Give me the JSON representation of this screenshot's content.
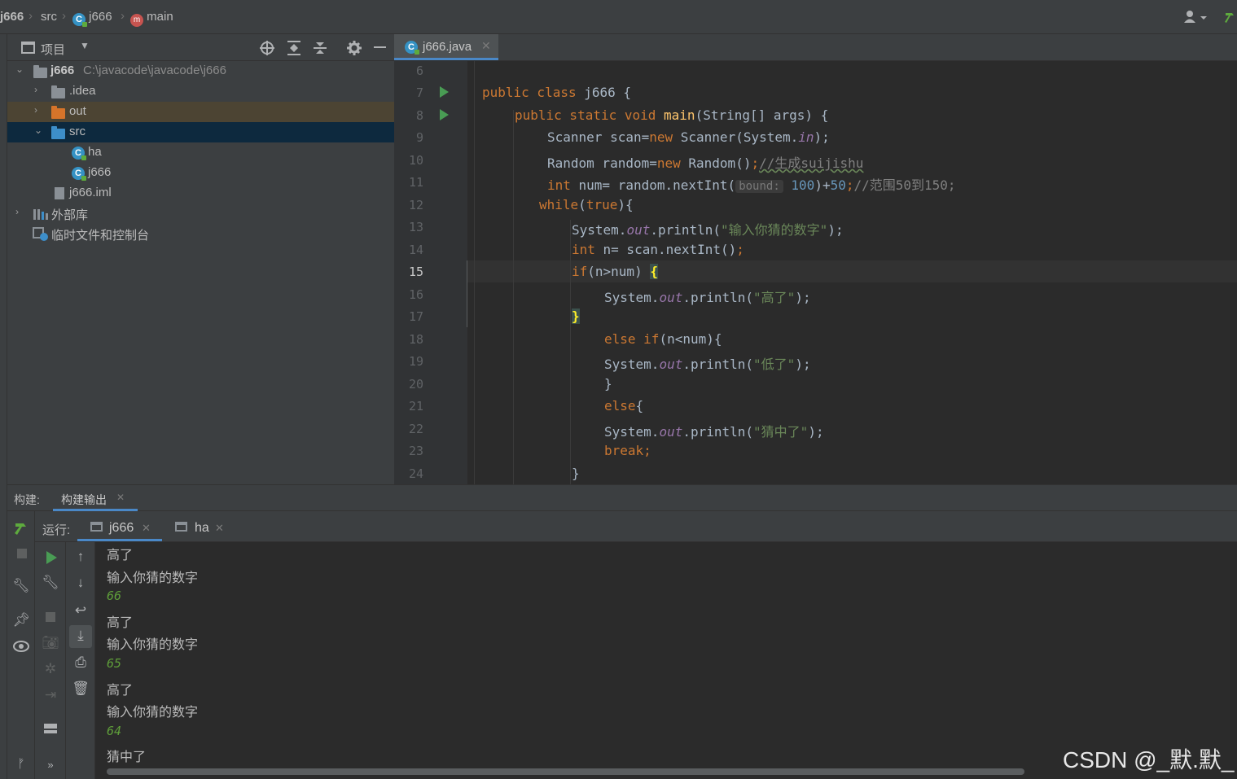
{
  "breadcrumb": {
    "project": "j666",
    "folder": "src",
    "file": "j666",
    "method": "main"
  },
  "project_panel": {
    "title": "项目",
    "tree": [
      {
        "label": "j666",
        "path": "C:\\javacode\\javacode\\j666"
      },
      {
        "label": ".idea"
      },
      {
        "label": "out"
      },
      {
        "label": "src"
      },
      {
        "label": "ha"
      },
      {
        "label": "j666"
      },
      {
        "label": "j666.iml"
      },
      {
        "label": "外部库"
      },
      {
        "label": "临时文件和控制台"
      }
    ]
  },
  "editor": {
    "tab": "j666.java",
    "line_numbers": [
      "6",
      "7",
      "8",
      "9",
      "10",
      "11",
      "12",
      "13",
      "14",
      "15",
      "16",
      "17",
      "18",
      "19",
      "20",
      "21",
      "22",
      "23",
      "24"
    ],
    "current_line": "15",
    "inlay_hint": "bound:",
    "lines": {
      "l7": {
        "a": "public class ",
        "b": "j666 {"
      },
      "l8": {
        "a": "public static void ",
        "b": "main",
        "c": "(String[] args) {"
      },
      "l9": {
        "a": "Scanner scan=",
        "b": "new ",
        "c": "Scanner(System.",
        "d": "in",
        "e": ");"
      },
      "l10": {
        "a": "Random random=",
        "b": "new ",
        "c": "Random()",
        "d": ";",
        "e": "//生成suijishu"
      },
      "l11": {
        "a": "int ",
        "b": "num= random.nextInt(",
        "c": "100",
        "d": ")+",
        "e": "50",
        "f": ";",
        "g": "//范围50到150;"
      },
      "l12": {
        "a": "while",
        "b": "(",
        "c": "true",
        "d": "){"
      },
      "l13": {
        "a": "System.",
        "b": "out",
        "c": ".println(",
        "d": "\"输入你猜的数字\"",
        "e": ");"
      },
      "l14": {
        "a": "int ",
        "b": "n= scan.nextInt()",
        "c": ";"
      },
      "l15": {
        "a": "if",
        "b": "(n>num) ",
        "c": "{"
      },
      "l16": {
        "a": "System.",
        "b": "out",
        "c": ".println(",
        "d": "\"高了\"",
        "e": ");"
      },
      "l17": {
        "a": "}"
      },
      "l18": {
        "a": "else if",
        "b": "(n<num){"
      },
      "l19": {
        "a": "System.",
        "b": "out",
        "c": ".println(",
        "d": "\"低了\"",
        "e": ");"
      },
      "l20": {
        "a": "}"
      },
      "l21": {
        "a": "else",
        "b": "{"
      },
      "l22": {
        "a": "System.",
        "b": "out",
        "c": ".println(",
        "d": "\"猜中了\"",
        "e": ");"
      },
      "l23": {
        "a": "break;"
      },
      "l24": {
        "a": "}"
      }
    }
  },
  "build": {
    "label": "构建:",
    "tab": "构建输出"
  },
  "run": {
    "label": "运行:",
    "tabs": [
      "j666",
      "ha"
    ]
  },
  "console": [
    {
      "text": "高了",
      "input": false
    },
    {
      "text": "输入你猜的数字",
      "input": false
    },
    {
      "text": "66",
      "input": true
    },
    {
      "text": "高了",
      "input": false
    },
    {
      "text": "输入你猜的数字",
      "input": false
    },
    {
      "text": "65",
      "input": true
    },
    {
      "text": "高了",
      "input": false
    },
    {
      "text": "输入你猜的数字",
      "input": false
    },
    {
      "text": "64",
      "input": true
    },
    {
      "text": "猜中了",
      "input": false
    }
  ],
  "watermark": "CSDN @_默.默_",
  "colors": {
    "keyword": "#cc7832",
    "string": "#6a8759",
    "number": "#6897bb",
    "field": "#9876aa",
    "method": "#ffc66d",
    "console_input": "#5f9e3a",
    "selection": "#0d293e"
  }
}
